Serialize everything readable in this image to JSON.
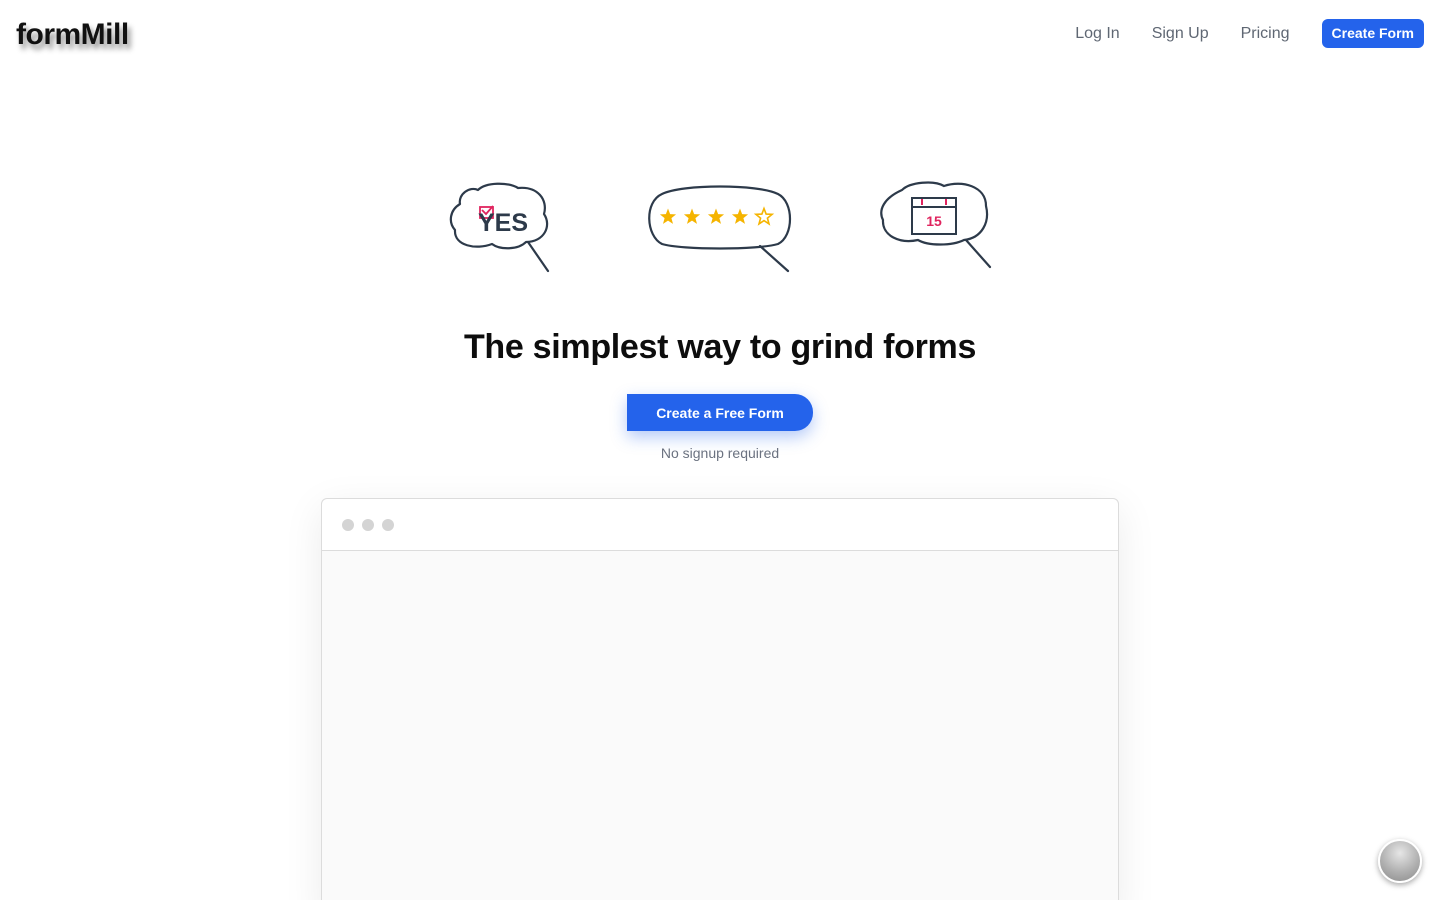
{
  "header": {
    "logo": "formMill",
    "nav": {
      "login": "Log In",
      "signup": "Sign Up",
      "pricing": "Pricing",
      "create_form": "Create Form"
    }
  },
  "illustrations": {
    "yes_text": "YES",
    "rating_stars_filled": 4,
    "rating_stars_total": 5,
    "calendar_day": "15"
  },
  "hero": {
    "headline": "The simplest way to grind forms",
    "cta_label": "Create a Free Form",
    "subtext": "No signup required"
  },
  "colors": {
    "accent": "#2463eb",
    "star": "#f5b400",
    "pink": "#e0245e",
    "ink": "#2d3a4a"
  },
  "icons": {
    "bubble_yes": "speech-bubble-yes-icon",
    "bubble_rating": "speech-bubble-rating-icon",
    "bubble_calendar": "speech-bubble-calendar-icon",
    "floating": "floating-orb-icon"
  }
}
